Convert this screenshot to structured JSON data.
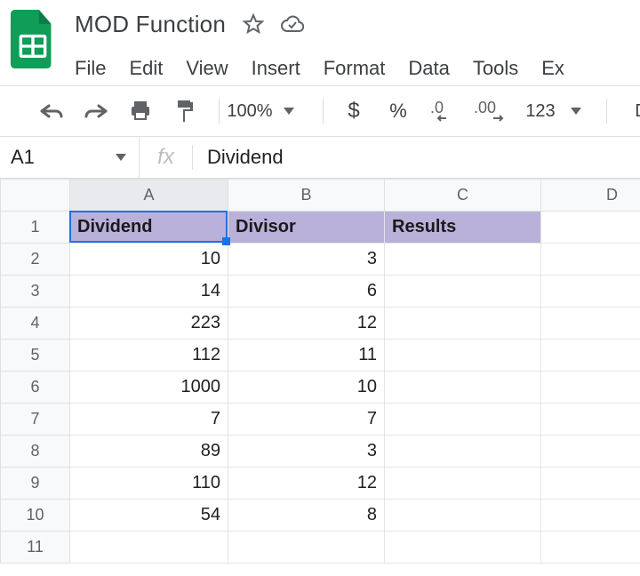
{
  "doc": {
    "title": "MOD Function"
  },
  "menus": [
    "File",
    "Edit",
    "View",
    "Insert",
    "Format",
    "Data",
    "Tools",
    "Ex"
  ],
  "toolbar": {
    "zoom": "100%",
    "fmt_more": "123",
    "font_stub": "De"
  },
  "formula": {
    "cell_ref": "A1",
    "value": "Dividend"
  },
  "columns": [
    "A",
    "B",
    "C",
    "D"
  ],
  "headers": {
    "a": "Dividend",
    "b": "Divisor",
    "c": "Results"
  },
  "rows": [
    {
      "n": "1"
    },
    {
      "n": "2",
      "a": "10",
      "b": "3"
    },
    {
      "n": "3",
      "a": "14",
      "b": "6"
    },
    {
      "n": "4",
      "a": "223",
      "b": "12"
    },
    {
      "n": "5",
      "a": "112",
      "b": "11"
    },
    {
      "n": "6",
      "a": "1000",
      "b": "10"
    },
    {
      "n": "7",
      "a": "7",
      "b": "7"
    },
    {
      "n": "8",
      "a": "89",
      "b": "3"
    },
    {
      "n": "9",
      "a": "110",
      "b": "12"
    },
    {
      "n": "10",
      "a": "54",
      "b": "8"
    },
    {
      "n": "11"
    }
  ]
}
